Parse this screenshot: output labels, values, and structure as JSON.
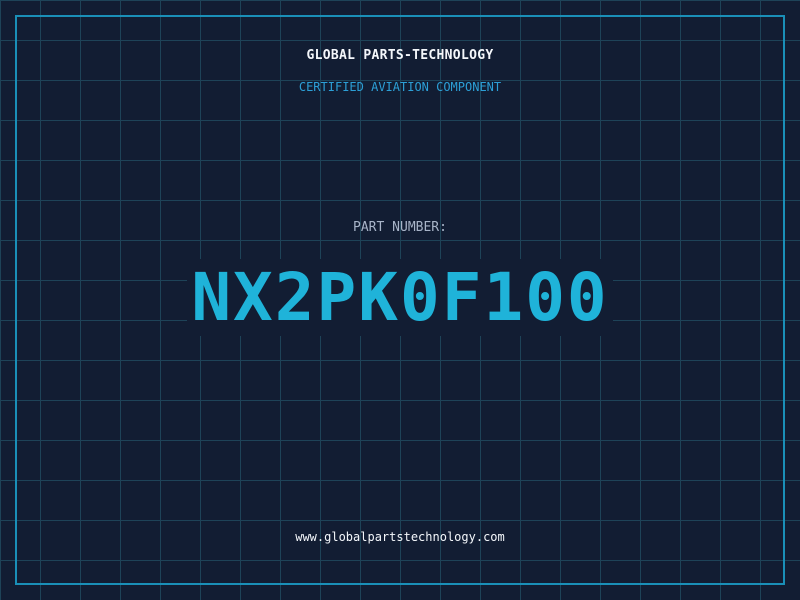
{
  "header": {
    "company_name": "GLOBAL PARTS-TECHNOLOGY",
    "tagline": "CERTIFIED AVIATION COMPONENT"
  },
  "part": {
    "label": "PART NUMBER:",
    "number": "NX2PK0F100"
  },
  "footer": {
    "website": "www.globalpartstechnology.com"
  },
  "colors": {
    "background": "#121d33",
    "grid": "#1e4358",
    "frame": "#1a8fb8",
    "accent": "#1fb3d9",
    "tagline": "#2c9fd6",
    "heading": "#f4f7fb",
    "label": "#a8b4c8"
  }
}
